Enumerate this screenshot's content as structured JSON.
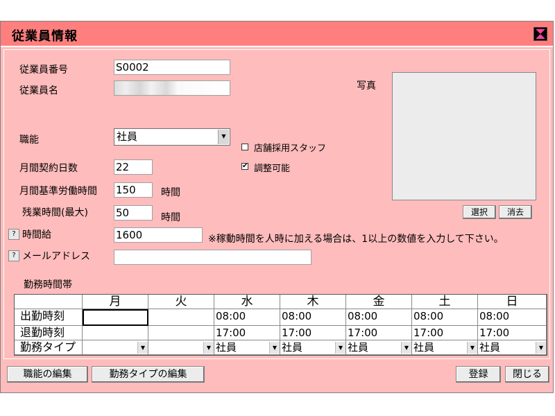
{
  "window": {
    "title": "従業員情報"
  },
  "form": {
    "emp_no_label": "従業員番号",
    "emp_no_value": "S0002",
    "emp_name_label": "従業員名",
    "role_label": "職能",
    "role_value": "社員",
    "contract_days_label": "月間契約日数",
    "contract_days_value": "22",
    "std_hours_label": "月間基準労働時間",
    "std_hours_value": "150",
    "std_hours_unit": "時間",
    "overtime_label": "残業時間(最大)",
    "overtime_value": "50",
    "overtime_unit": "時間",
    "hourly_label": "時間給",
    "hourly_value": "1600",
    "hourly_note": "※稼動時間を人時に加える場合は、1以上の数値を入力して下さい。",
    "email_label": "メールアドレス",
    "email_value": "",
    "store_staff_label": "店舗採用スタッフ",
    "store_staff_checked": false,
    "adjustable_label": "調整可能",
    "adjustable_checked": true,
    "photo_label": "写真",
    "select_button": "選択",
    "clear_button": "消去",
    "help_glyph": "?"
  },
  "schedule": {
    "title": "勤務時間帯",
    "days": [
      "月",
      "火",
      "水",
      "木",
      "金",
      "土",
      "日"
    ],
    "rows": [
      {
        "label": "出勤時刻",
        "values": [
          "",
          "",
          "08:00",
          "08:00",
          "08:00",
          "08:00",
          "08:00"
        ]
      },
      {
        "label": "退勤時刻",
        "values": [
          "",
          "",
          "17:00",
          "17:00",
          "17:00",
          "17:00",
          "17:00"
        ]
      },
      {
        "label": "勤務タイプ",
        "values": [
          "",
          "",
          "社員",
          "社員",
          "社員",
          "社員",
          "社員"
        ]
      }
    ]
  },
  "footer": {
    "edit_role_button": "職能の編集",
    "edit_worktype_button": "勤務タイプの編集",
    "register_button": "登録",
    "close_button": "閉じる"
  },
  "colors": {
    "title_bar": "#ff7f7f",
    "window_bg": "#ffbcbc"
  },
  "icons": {
    "close": "close-x-icon",
    "dropdown": "chevron-down-icon"
  }
}
